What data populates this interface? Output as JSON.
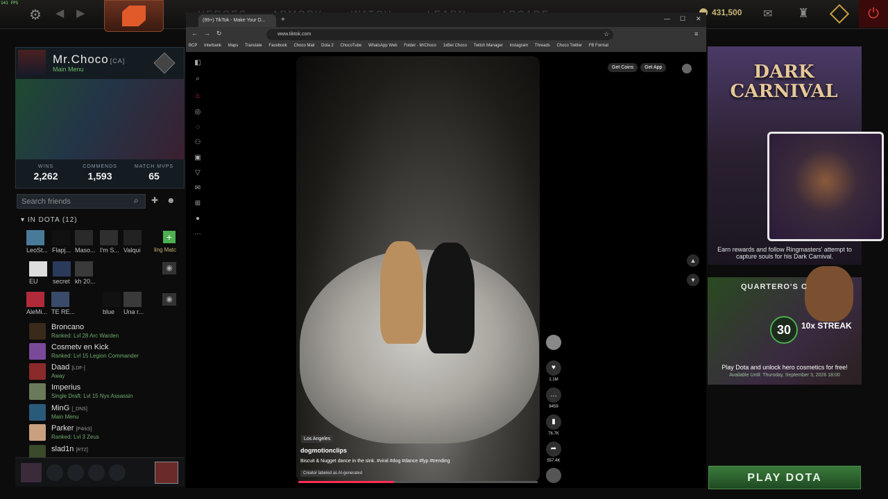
{
  "top_bar": {
    "fps": "141 FPS",
    "nav": [
      "HEROES",
      "ARMORY",
      "WATCH",
      "LEARN",
      "ARCADE"
    ],
    "currency": "431,500"
  },
  "profile": {
    "name": "Mr.Choco",
    "tag": "[CA]",
    "status": "Main Menu",
    "stats": [
      {
        "label": "WINS",
        "value": "2,262"
      },
      {
        "label": "COMMENDS",
        "value": "1,593"
      },
      {
        "label": "MATCH MVPS",
        "value": "65"
      }
    ]
  },
  "friends": {
    "search_placeholder": "Search friends",
    "in_dota_header": "IN DOTA (12)",
    "grid": [
      "LeoSt...",
      "Flapj...",
      "Maso...",
      "I'm S...",
      "Valqui",
      "EU",
      "secret",
      "kh 20...",
      "AleMi...",
      "TE RE...",
      "blue",
      "Una r..."
    ],
    "list": [
      {
        "name": "Broncano",
        "tag": "",
        "status": "Ranked: Lvl 28 Arc Warden"
      },
      {
        "name": "Cosmetv en Kick",
        "tag": "",
        "status": "Ranked: Lvl 15 Legion Commander"
      },
      {
        "name": "Daad",
        "tag": "[LDF-]",
        "status": "Away"
      },
      {
        "name": "Imperius",
        "tag": "",
        "status": "Single Draft: Lvl 15 Nyx Assassin"
      },
      {
        "name": "MinG",
        "tag": "[_DNS]",
        "status": "Main Menu"
      },
      {
        "name": "Parker",
        "tag": "[P4rkS]",
        "status": "Ranked: Lvl 3 Zeus"
      },
      {
        "name": "slad1n",
        "tag": "[RTZ]",
        "status": ""
      }
    ]
  },
  "browser": {
    "tab_title": "(99+) TikTok - Make Your D...",
    "url": "www.tiktok.com",
    "bookmarks": [
      "BCP",
      "Interbank",
      "Maps",
      "Translate",
      "Facebook",
      "Choco Mail",
      "Dota 2",
      "ChocoTube",
      "WhatsApp Web",
      "Folder - MrChoco",
      "1xBet Choco",
      "Twitch Manager",
      "Instagram",
      "Threads",
      "Choco Twitter",
      "FB Format"
    ]
  },
  "tiktok": {
    "get_coins": "Get Coins",
    "get_app": "Get App",
    "location": "Los Angeles",
    "author": "dogmotionclips",
    "caption": "Biscuit & Nugget dance in the sink. #viral #dog #dance #fyp #trending",
    "ai_label": "Creator labeled as AI-generated",
    "progress": 0.4,
    "likes": "1.1M",
    "comments": "8459",
    "saves": "76.7K",
    "shares": "557.4K"
  },
  "event": {
    "title": "DARK CARNIVAL",
    "description": "Earn rewards and follow Ringmasters' attempt to capture souls for his Dark Carnival."
  },
  "quest": {
    "title": "QUARTERO'S C",
    "streak": "30",
    "streak_label": "10x STREAK",
    "description": "Play Dota and unlock hero cosmetics for free!",
    "until": "Available Until: Thursday, September 3, 2026 18:00"
  },
  "play_button": "PLAY DOTA"
}
